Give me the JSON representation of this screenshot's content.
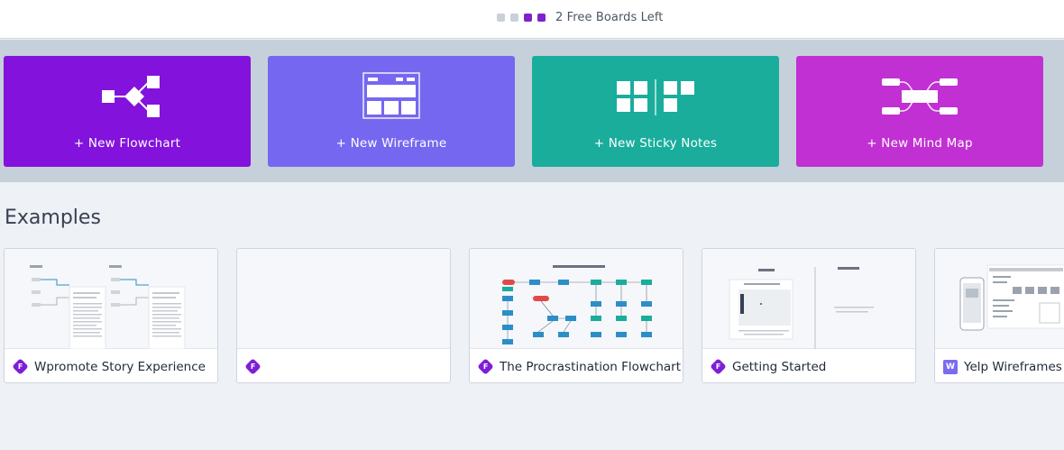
{
  "header": {
    "boards_left_text": "2 Free Boards Left",
    "indicator_colors": [
      "#c9d0da",
      "#c9d0da",
      "#7e22ce",
      "#7e22ce"
    ]
  },
  "templates": [
    {
      "label": "+ New Flowchart",
      "color": "#8312dd",
      "icon": "flowchart-icon"
    },
    {
      "label": "+ New Wireframe",
      "color": "#7667f1",
      "icon": "wireframe-icon"
    },
    {
      "label": "+ New Sticky Notes",
      "color": "#1aad9c",
      "icon": "sticky-notes-icon"
    },
    {
      "label": "+ New Mind Map",
      "color": "#c130d2",
      "icon": "mind-map-icon"
    }
  ],
  "examples": {
    "title": "Examples",
    "cards": [
      {
        "name": "Wpromote Story Experience",
        "badge": "F",
        "badge_type": "flowchart"
      },
      {
        "name": "",
        "badge": "F",
        "badge_type": "flowchart"
      },
      {
        "name": "The Procrastination Flowchart",
        "badge": "F",
        "badge_type": "flowchart"
      },
      {
        "name": "Getting Started",
        "badge": "F",
        "badge_type": "flowchart"
      },
      {
        "name": "Yelp Wireframes",
        "badge": "W",
        "badge_type": "wireframe"
      }
    ]
  }
}
